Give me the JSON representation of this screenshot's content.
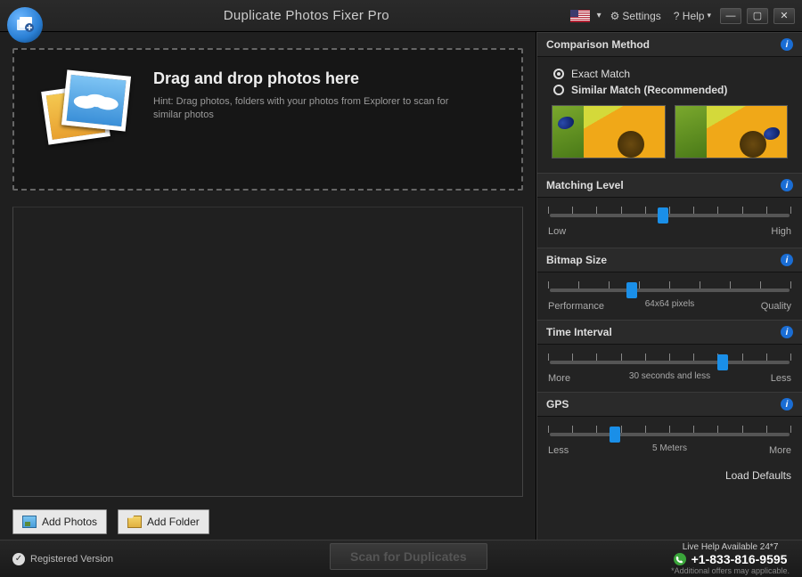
{
  "titlebar": {
    "title": "Duplicate Photos Fixer Pro",
    "settings": "Settings",
    "help": "? Help",
    "language_flag": "us"
  },
  "dropzone": {
    "heading": "Drag and drop photos here",
    "hint": "Hint: Drag photos, folders with your photos from Explorer to scan for similar photos"
  },
  "buttons": {
    "add_photos": "Add Photos",
    "add_folder": "Add Folder",
    "scan": "Scan for Duplicates"
  },
  "footer": {
    "registered": "Registered Version",
    "help_line1": "Live Help Available 24*7",
    "help_phone": "+1-833-816-9595",
    "help_disclaimer": "*Additional offers may applicable."
  },
  "panel": {
    "comparison": {
      "title": "Comparison Method",
      "exact": "Exact Match",
      "similar": "Similar Match (Recommended)",
      "selected": "exact"
    },
    "matching": {
      "title": "Matching Level",
      "low": "Low",
      "high": "High",
      "value_pct": 45
    },
    "bitmap": {
      "title": "Bitmap Size",
      "low": "Performance",
      "high": "Quality",
      "center": "64x64 pixels",
      "value_pct": 32
    },
    "time": {
      "title": "Time Interval",
      "low": "More",
      "high": "Less",
      "center": "30 seconds and less",
      "value_pct": 70
    },
    "gps": {
      "title": "GPS",
      "low": "Less",
      "high": "More",
      "center": "5 Meters",
      "value_pct": 25
    },
    "load_defaults": "Load Defaults"
  }
}
